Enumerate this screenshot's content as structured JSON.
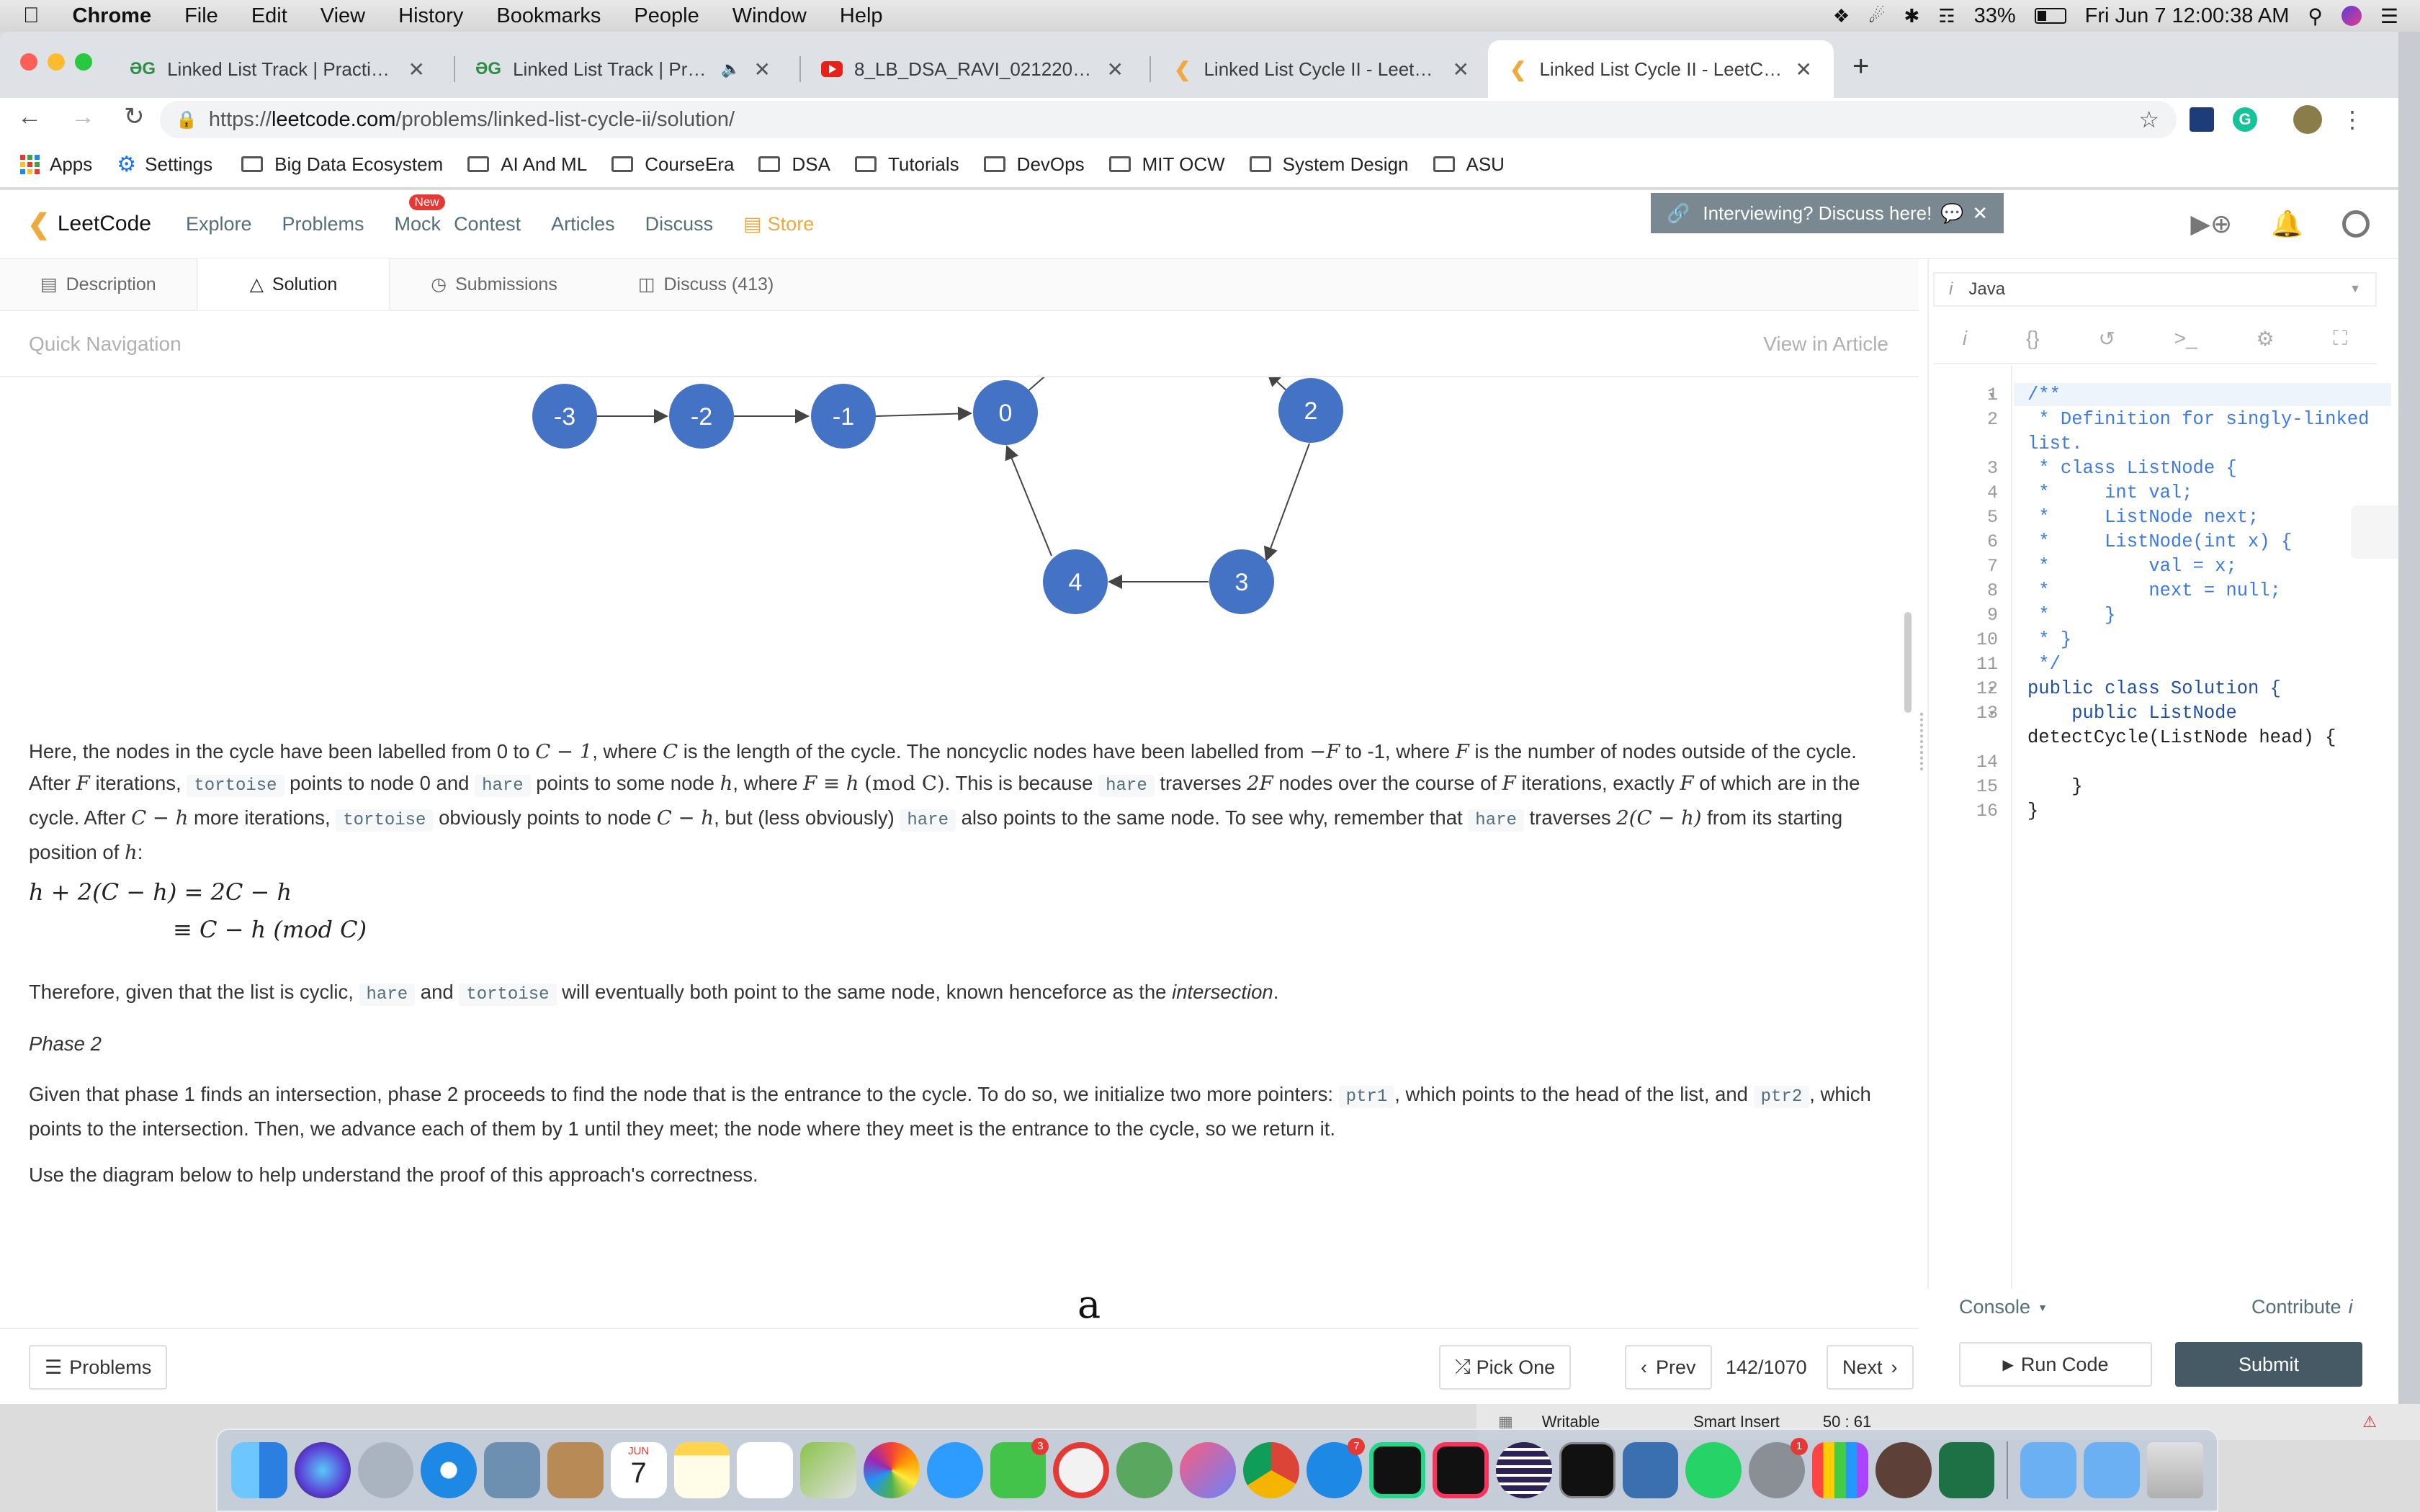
{
  "menubar": {
    "items": [
      "Chrome",
      "File",
      "Edit",
      "View",
      "History",
      "Bookmarks",
      "People",
      "Window",
      "Help"
    ],
    "battery": "33%",
    "clock": "Fri Jun 7  12:00:38 AM"
  },
  "browser": {
    "tabs": [
      {
        "title": "Linked List Track | Practice | Ge"
      },
      {
        "title": "Linked List Track | Practice"
      },
      {
        "title": "8_LB_DSA_RAVI_02122017 - Yo"
      },
      {
        "title": "Linked List Cycle II - LeetCode"
      },
      {
        "title": "Linked List Cycle II - LeetCode"
      }
    ],
    "url_prefix": "https://",
    "url_domain": "leetcode.com",
    "url_path": "/problems/linked-list-cycle-ii/solution/",
    "bookmarks": [
      "Apps",
      "Settings",
      "Big Data Ecosystem",
      "AI And ML",
      "CourseEra",
      "DSA",
      "Tutorials",
      "DevOps",
      "MIT OCW",
      "System Design",
      "ASU"
    ]
  },
  "nav": {
    "brand": "LeetCode",
    "links": [
      "Explore",
      "Problems",
      "Mock",
      "Contest",
      "Articles",
      "Discuss",
      "Store"
    ],
    "new_badge": "New",
    "banner": "Interviewing? Discuss here!"
  },
  "subtabs": [
    "Description",
    "Solution",
    "Submissions",
    "Discuss (413)"
  ],
  "quicknav": {
    "label": "Quick Navigation",
    "view": "View in Article"
  },
  "diagram": {
    "nodes": [
      "-3",
      "-2",
      "-1",
      "0",
      "2",
      "4",
      "3"
    ]
  },
  "article": {
    "p1_a": "Here, the nodes in the cycle have been labelled from 0 to ",
    "C_minus_1": "C − 1",
    "p1_b": ", where ",
    "C": "C",
    "p1_c": " is the length of the cycle. The noncyclic nodes have been labelled from ",
    "neg_F": "−F",
    "p1_d": " to -1, where ",
    "F": "F",
    "p1_e": " is the number of nodes outside of the cycle. After ",
    "p1_f": " iterations, ",
    "tortoise": "tortoise",
    "p1_g": " points to node 0 and ",
    "hare": "hare",
    "p1_h": " points to some node ",
    "h": "h",
    "p1_i": ", where ",
    "F_equiv": "F ≡ h",
    "mod_C": "(mod C)",
    "p1_j": ". This is because ",
    "p1_k": " traverses ",
    "two_F": "2F",
    "p1_l": " nodes over the course of ",
    "p1_m": " iterations, exactly ",
    "p1_n": " of which are in the cycle. After ",
    "C_minus_h": "C − h",
    "p1_o": " more iterations, ",
    "p1_p": " obviously points to node ",
    "p1_q": ", but (less obviously) ",
    "p1_r": " also points to the same node. To see why, remember that ",
    "p1_s": " traverses ",
    "two_C_minus_h": "2(C − h)",
    "p1_t": " from its starting position of ",
    "p1_u": ":",
    "eq1": "h + 2(C − h) = 2C − h",
    "eq2": "≡ C − h   (mod C)",
    "p2_a": "Therefore, given that the list is cyclic, ",
    "p2_b": " and ",
    "p2_c": " will eventually both point to the same node, known henceforce as the ",
    "intersection": "intersection",
    "p2_d": ".",
    "phase2": "Phase 2",
    "p3_a": "Given that phase 1 finds an intersection, phase 2 proceeds to find the node that is the entrance to the cycle. To do so, we initialize two more pointers: ",
    "ptr1": "ptr1",
    "p3_b": ", which points to the head of the list, and ",
    "ptr2": "ptr2",
    "p3_c": ", which points to the intersection. Then, we advance each of them by 1 until they meet; the node where they meet is the entrance to the cycle, so we return it.",
    "p4": "Use the diagram below to help understand the proof of this approach's correctness.",
    "figure_a": "a"
  },
  "editor": {
    "language": "Java",
    "tools": [
      "i",
      "{}",
      "↺",
      ">_",
      "⚙",
      "⛶"
    ],
    "lines": [
      {
        "n": "1",
        "text": "/**"
      },
      {
        "n": "2",
        "text": " * Definition for singly-linked"
      },
      {
        "n": "",
        "text": "list."
      },
      {
        "n": "3",
        "text": " * class ListNode {"
      },
      {
        "n": "4",
        "text": " *     int val;"
      },
      {
        "n": "5",
        "text": " *     ListNode next;"
      },
      {
        "n": "6",
        "text": " *     ListNode(int x) {"
      },
      {
        "n": "7",
        "text": " *         val = x;"
      },
      {
        "n": "8",
        "text": " *         next = null;"
      },
      {
        "n": "9",
        "text": " *     }"
      },
      {
        "n": "10",
        "text": " * }"
      },
      {
        "n": "11",
        "text": " */"
      },
      {
        "n": "12",
        "text": "public class Solution {"
      },
      {
        "n": "13",
        "text": "    public ListNode"
      },
      {
        "n": "",
        "text": "detectCycle(ListNode head) {"
      },
      {
        "n": "14",
        "text": ""
      },
      {
        "n": "15",
        "text": "    }"
      },
      {
        "n": "16",
        "text": "}"
      }
    ],
    "console": "Console",
    "contribute": "Contribute",
    "run": "Run Code",
    "submit": "Submit"
  },
  "bottom": {
    "problems": "Problems",
    "pick": "Pick One",
    "prev": "Prev",
    "counter": "142/1070",
    "next": "Next"
  },
  "statusstrip": {
    "writable": "Writable",
    "insert": "Smart Insert",
    "pos": "50 : 61"
  },
  "dock": {
    "calendar_month": "JUN",
    "calendar_day": "7",
    "badge_facetime": "3",
    "badge_appstore": "7",
    "badge_prefs": "1"
  },
  "colors": {
    "node_fill": "#4472c4",
    "accent": "#f0a93b",
    "submit_bg": "#455a64"
  }
}
